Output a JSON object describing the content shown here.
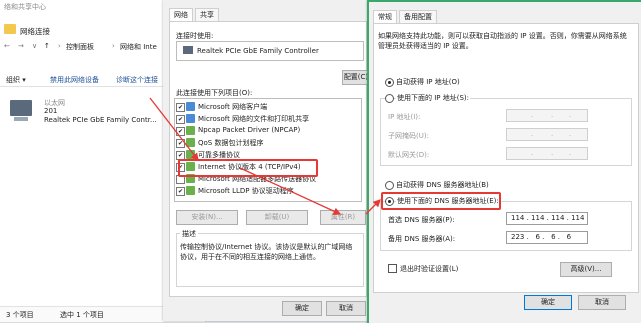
{
  "conn_window": {
    "title": "络和共享中心",
    "subtitle": "网络连接",
    "address": {
      "up": "↑",
      "seg1": "控制面板",
      "seg2": "网络和 Inte"
    },
    "toolbar": {
      "organize": "组织 ▾",
      "disable": "禁用此网络设备",
      "diagnose": "诊断这个连接"
    },
    "adapter": {
      "name": "以太网",
      "status": "201",
      "device": "Realtek PCIe GbE Family Contr..."
    },
    "status_bar": {
      "count": "3 个项目",
      "selected": "选中 1 个项目"
    }
  },
  "props_window": {
    "tabs": [
      "网络",
      "共享"
    ],
    "connect_using_label": "连接时使用:",
    "adapter_name": "Realtek PCIe GbE Family Controller",
    "configure_button": "配置(C)",
    "items_label": "此连接使用下列项目(O):",
    "items": [
      {
        "label": "Microsoft 网络客户端",
        "checked": true
      },
      {
        "label": "Microsoft 网络的文件和打印机共享",
        "checked": true
      },
      {
        "label": "Npcap Packet Driver (NPCAP)",
        "checked": true
      },
      {
        "label": "QoS 数据包计划程序",
        "checked": true
      },
      {
        "label": "可靠多播协议",
        "checked": true
      },
      {
        "label": "Internet 协议版本 4 (TCP/IPv4)",
        "checked": true
      },
      {
        "label": "Microsoft 网络适配器多路传送器协议",
        "checked": false
      },
      {
        "label": "Microsoft LLDP 协议驱动程序",
        "checked": true
      }
    ],
    "install_button": "安装(N)...",
    "uninstall_button": "卸载(U)",
    "properties_button": "属性(R)",
    "description_label": "描述",
    "description_text": "传输控制协议/Internet 协议。该协议是默认的广域网络协议，用于在不同的相互连接的网络上通信。",
    "ok_button": "确定",
    "cancel_button": "取消"
  },
  "ipv4_window": {
    "tabs": [
      "常规",
      "备用配置"
    ],
    "intro": "如果网络支持此功能，则可以获取自动指派的 IP 设置。否则，你需要从网络系统管理员处获得适当的 IP 设置。",
    "auto_ip": "自动获得 IP 地址(O)",
    "manual_ip": "使用下面的 IP 地址(S):",
    "ip_label": "IP 地址(I):",
    "mask_label": "子网掩码(U):",
    "gateway_label": "默认网关(D):",
    "auto_dns": "自动获得 DNS 服务器地址(B)",
    "manual_dns": "使用下面的 DNS 服务器地址(E):",
    "preferred_dns_label": "首选 DNS 服务器(P):",
    "preferred_dns_value": "114 . 114 . 114 . 114",
    "alternate_dns_label": "备用 DNS 服务器(A):",
    "alternate_dns_value": "223 .   6 .   6 .   6",
    "validate_exit": "退出时验证设置(L)",
    "advanced_button": "高级(V)...",
    "ok_button": "确定",
    "cancel_button": "取消",
    "accent": "#3aa86b"
  },
  "annotation_color": "#e53935"
}
